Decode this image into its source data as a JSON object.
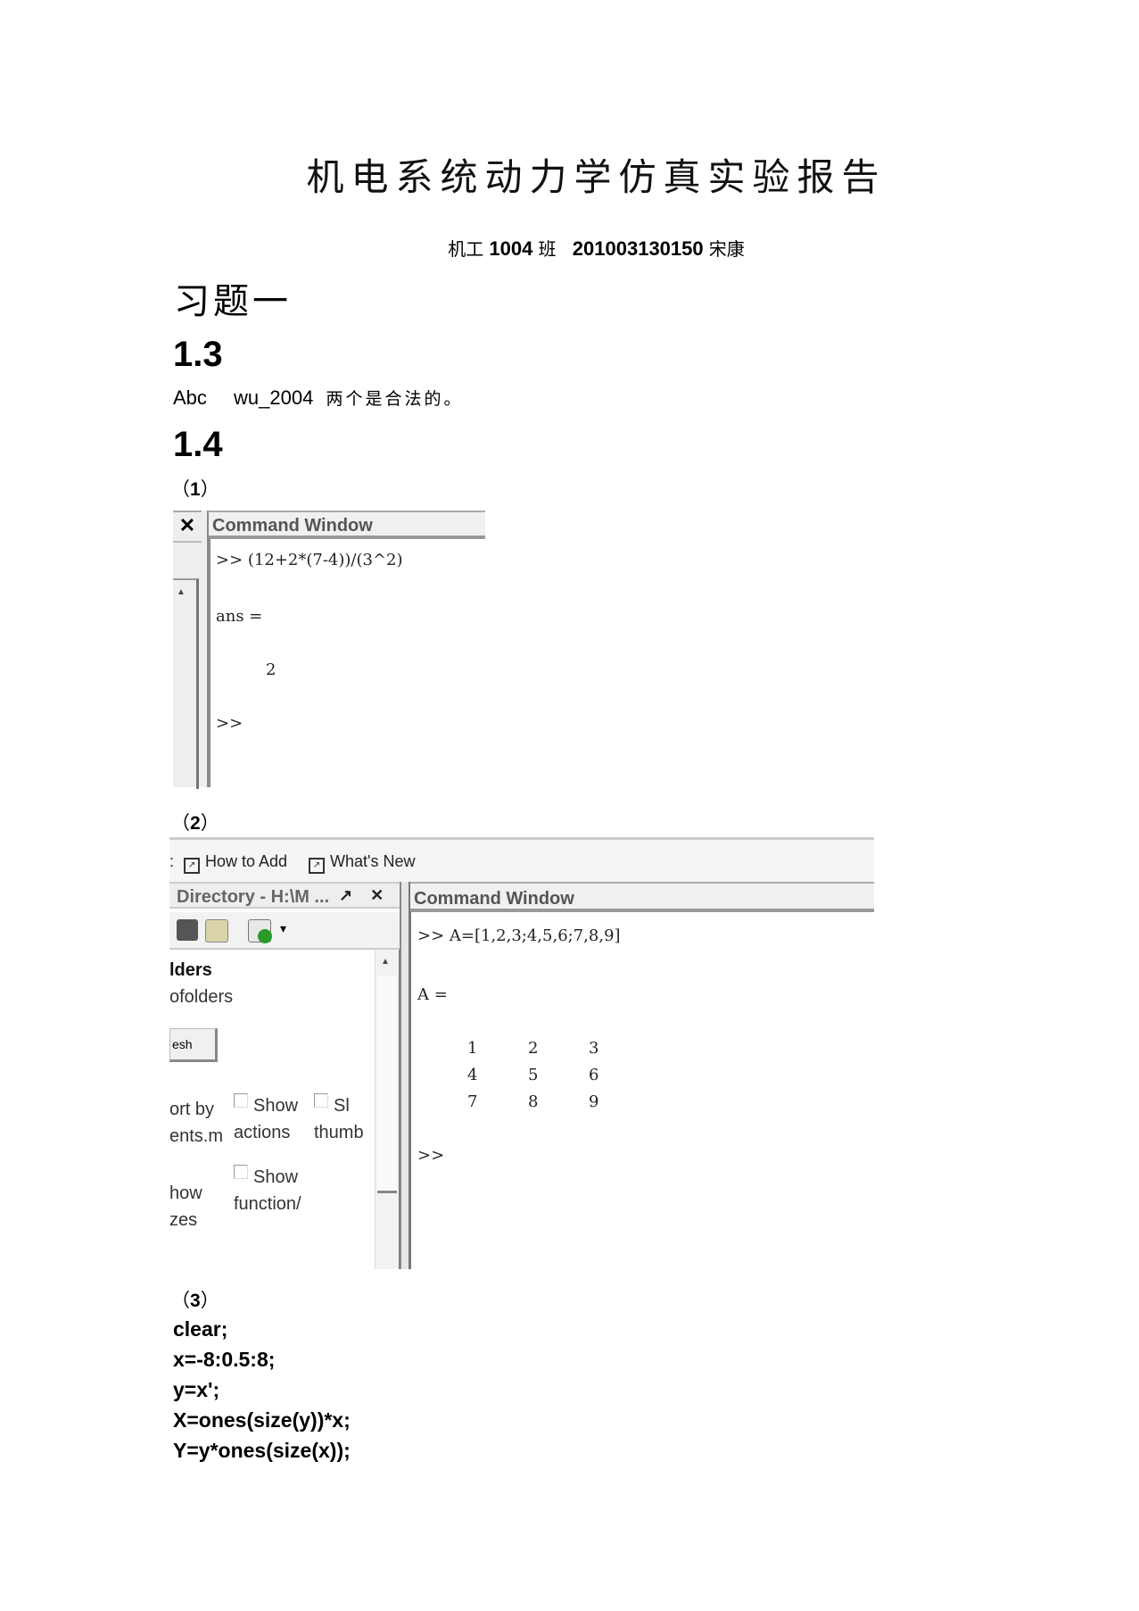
{
  "document": {
    "title": "机电系统动力学仿真实验报告",
    "author_line": {
      "class_prefix": "机工",
      "class_number": "1004",
      "class_suffix": "班",
      "student_id": "201003130150",
      "name": "宋康"
    },
    "chapter_heading": "习题一",
    "sections": [
      {
        "heading": "1.3",
        "answer": {
          "identifier_1": "Abc",
          "identifier_2": "wu_2004",
          "text": "两个是合法的。"
        }
      },
      {
        "heading": "1.4",
        "parts": [
          {
            "label_open": "（",
            "number": "1",
            "label_close": "）"
          },
          {
            "label_open": "（",
            "number": "2",
            "label_close": "）"
          },
          {
            "label_open": "（",
            "number": "3",
            "label_close": "）"
          }
        ]
      }
    ],
    "code_part3": [
      "clear;",
      "x=-8:0.5:8;",
      "y=x';",
      "X=ones(size(y))*x;",
      "Y=y*ones(size(x));"
    ]
  },
  "screenshot1": {
    "close_glyph": "✕",
    "scroll_up_glyph": "▲",
    "panel_title": "Command Window",
    "lines": [
      ">>  (12+2*(7-4))/(3^2)",
      "ans =",
      "2",
      ">>"
    ]
  },
  "screenshot2": {
    "toolbar": {
      "cut_prefix": ":",
      "links": [
        "How to Add",
        "What's New"
      ],
      "shortcut_glyph": "↗"
    },
    "directory_panel": {
      "title": "Directory - H:\\M ...",
      "undock_glyph": "↗",
      "close_glyph": "✕",
      "dropdown_glyph": "▾",
      "scroll_up_glyph": "▲",
      "heading": "lders",
      "subtext": "ofolders",
      "refresh_button": "esh",
      "options": [
        {
          "line1": "ort by",
          "line2": "ents.m"
        },
        {
          "line1": "Show",
          "line2": "actions",
          "checked": false
        },
        {
          "line1": "Sl",
          "line2": "thumb",
          "checked": false
        },
        {
          "line1": "how",
          "line2": "zes"
        },
        {
          "line1": "Show",
          "line2": "function/",
          "checked": false
        }
      ]
    },
    "command_window": {
      "title": "Command Window",
      "command": ">>  A=[1,2,3;4,5,6;7,8,9]",
      "result_label": "A =",
      "matrix": [
        [
          "1",
          "2",
          "3"
        ],
        [
          "4",
          "5",
          "6"
        ],
        [
          "7",
          "8",
          "9"
        ]
      ],
      "prompt": ">>"
    }
  }
}
